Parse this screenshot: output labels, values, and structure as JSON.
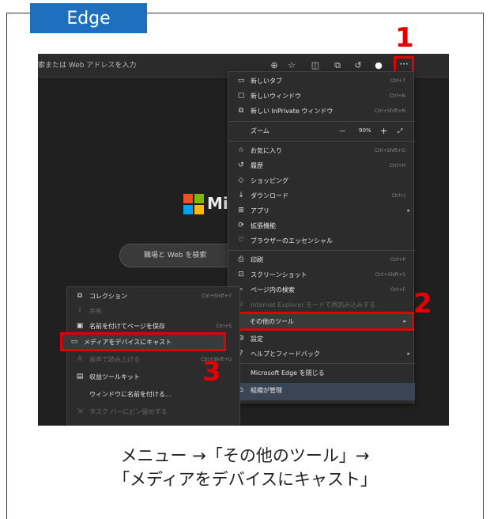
{
  "badge": "Edge",
  "addressbar": {
    "placeholder": "索または Web アドレスを入力"
  },
  "toolbar": {
    "more": "···"
  },
  "newtab": {
    "logo_text": "Mi",
    "search_placeholder": "職場と Web を検索"
  },
  "menu": {
    "items": [
      {
        "icon": "new-tab-icon",
        "glyph": "▭",
        "label": "新しいタブ",
        "shortcut": "Ctrl+T"
      },
      {
        "icon": "new-window-icon",
        "glyph": "▢",
        "label": "新しいウィンドウ",
        "shortcut": "Ctrl+N"
      },
      {
        "icon": "inprivate-icon",
        "glyph": "⧉",
        "label": "新しい InPrivate ウィンドウ",
        "shortcut": "Ctrl+Shift+N"
      },
      {
        "icon": "",
        "glyph": "",
        "label": "ズーム",
        "shortcut": ""
      },
      {
        "icon": "favorites-icon",
        "glyph": "☆",
        "label": "お気に入り",
        "shortcut": "Ctrl+Shift+O"
      },
      {
        "icon": "history-icon",
        "glyph": "↺",
        "label": "履歴",
        "shortcut": "Ctrl+H"
      },
      {
        "icon": "shopping-icon",
        "glyph": "◇",
        "label": "ショッピング",
        "shortcut": ""
      },
      {
        "icon": "download-icon",
        "glyph": "↓",
        "label": "ダウンロード",
        "shortcut": "Ctrl+J"
      },
      {
        "icon": "apps-icon",
        "glyph": "⊞",
        "label": "アプリ",
        "shortcut": ""
      },
      {
        "icon": "extensions-icon",
        "glyph": "⟳",
        "label": "拡張機能",
        "shortcut": ""
      },
      {
        "icon": "essentials-icon",
        "glyph": "♡",
        "label": "ブラウザーのエッセンシャル",
        "shortcut": ""
      },
      {
        "icon": "print-icon",
        "glyph": "⎙",
        "label": "印刷",
        "shortcut": "Ctrl+P"
      },
      {
        "icon": "screenshot-icon",
        "glyph": "⊡",
        "label": "スクリーンショット",
        "shortcut": "Ctrl+Shift+S"
      },
      {
        "icon": "find-icon",
        "glyph": "⌕",
        "label": "ページ内の検索",
        "shortcut": "Ctrl+F"
      },
      {
        "icon": "ie-icon",
        "glyph": "e",
        "label": "Internet Explorer モードで再読み込みする",
        "shortcut": ""
      },
      {
        "icon": "",
        "glyph": "",
        "label": "その他のツール",
        "shortcut": ""
      },
      {
        "icon": "settings-icon",
        "glyph": "⚙",
        "label": "設定",
        "shortcut": ""
      },
      {
        "icon": "help-icon",
        "glyph": "?",
        "label": "ヘルプとフィードバック",
        "shortcut": ""
      },
      {
        "icon": "",
        "glyph": "",
        "label": "Microsoft Edge を閉じる",
        "shortcut": ""
      },
      {
        "icon": "org-icon",
        "glyph": "⌂",
        "label": "組織が管理",
        "shortcut": ""
      }
    ],
    "zoom_value": "90%"
  },
  "submenu": {
    "items": [
      {
        "icon": "collections-icon",
        "glyph": "⧉",
        "label": "コレクション",
        "shortcut": "Ctrl+Shift+Y"
      },
      {
        "icon": "share-icon",
        "glyph": "⇪",
        "label": "共有",
        "shortcut": ""
      },
      {
        "icon": "save-page-icon",
        "glyph": "▣",
        "label": "名前を付けてページを保存",
        "shortcut": "Ctrl+S"
      },
      {
        "icon": "cast-icon",
        "glyph": "▭",
        "label": "メディアをデバイスにキャスト",
        "shortcut": ""
      },
      {
        "icon": "read-aloud-icon",
        "glyph": "A",
        "label": "音声で読み上げる",
        "shortcut": "Ctrl+Shift+U"
      },
      {
        "icon": "devtools-icon",
        "glyph": "▤",
        "label": "収益ツールキット",
        "shortcut": ""
      },
      {
        "icon": "",
        "glyph": "",
        "label": "ウィンドウに名前を付ける...",
        "shortcut": ""
      },
      {
        "icon": "pin-icon",
        "glyph": "⇲",
        "label": "タスク バーにピン留めする",
        "shortcut": ""
      }
    ]
  },
  "steps": [
    "1",
    "2",
    "3"
  ],
  "caption": [
    "メニュー →「その他のツール」→",
    "「メディアをデバイスにキャスト」"
  ]
}
